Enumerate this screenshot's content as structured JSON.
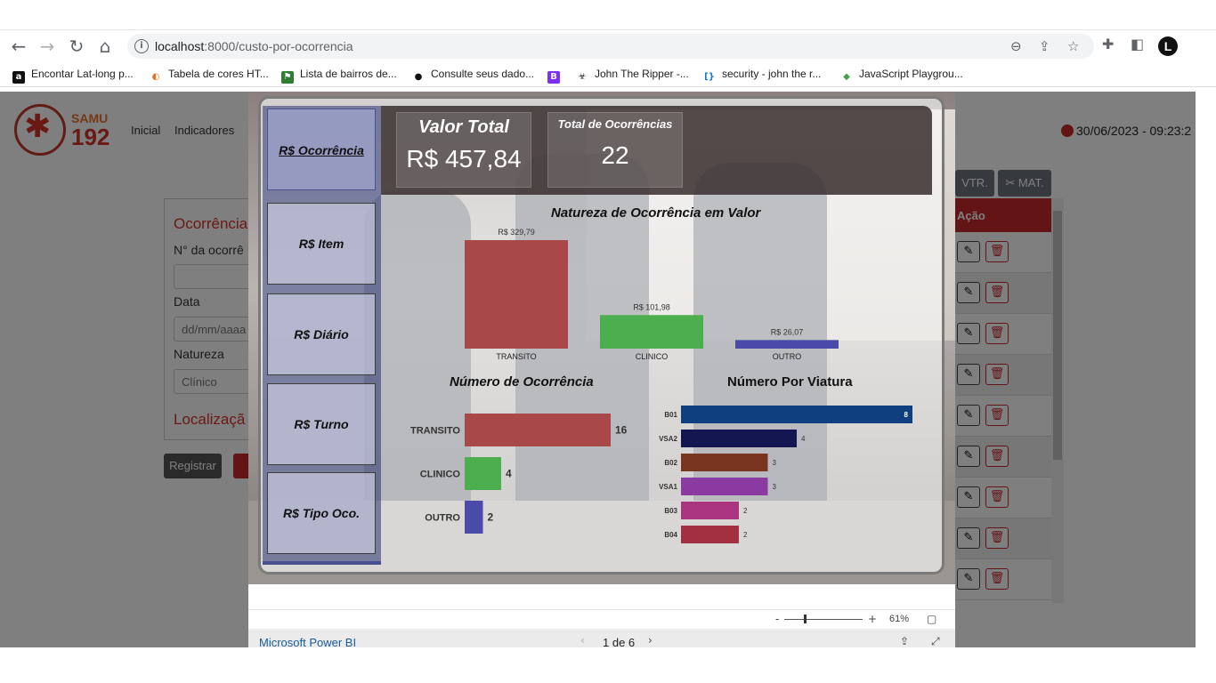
{
  "browser": {
    "url_host": "localhost",
    "url_path": ":8000/custo-por-ocorrencia",
    "bookmarks": [
      {
        "label": "Encontar Lat-long p...",
        "icon": "a",
        "color": "#111"
      },
      {
        "label": "Tabela de cores HT...",
        "icon": "◐",
        "color": "#e8731a"
      },
      {
        "label": "Lista de bairros de...",
        "icon": "⚑",
        "color": "#2e7d32"
      },
      {
        "label": "Consulte seus dado...",
        "icon": "●",
        "color": "#111"
      },
      {
        "label": "",
        "icon": "B",
        "color": "#7b2ff7"
      },
      {
        "label": "John The Ripper -...",
        "icon": "☣",
        "color": "#222"
      },
      {
        "label": "security - john the r...",
        "icon": "[}",
        "color": "#1976d2"
      },
      {
        "label": "JavaScript Playgrou...",
        "icon": "◆",
        "color": "#43a047"
      }
    ],
    "avatar": "L"
  },
  "app": {
    "brand_top": "SAMU",
    "brand_num": "192",
    "nav": [
      "Inicial",
      "Indicadores"
    ],
    "datetime": "30/06/2023 - 09:23:2",
    "form": {
      "title": "Ocorrência",
      "title2": "Localizaçã",
      "label_numero": "N° da ocorrê",
      "label_data": "Data",
      "date_placeholder": "dd/mm/aaaa",
      "label_natureza": "Natureza",
      "natureza_value": "Clínico",
      "register_button": "Registrar"
    },
    "top_buttons": [
      "VTR.",
      "MAT."
    ],
    "table_header": "Ação",
    "row_count": 9
  },
  "report": {
    "nav_buttons": [
      "R$ Ocorrência",
      "R$ Item",
      "R$ Diário",
      "R$ Turno",
      "R$ Tipo Oco."
    ],
    "kpi_total_label": "Valor Total",
    "kpi_total_value": "R$ 457,84",
    "kpi_count_label": "Total de Ocorrências",
    "kpi_count_value": "22",
    "chart1_title": "Natureza de Ocorrência em Valor",
    "chart2_title": "Número de Ocorrência",
    "chart3_title": "Número Por Viatura"
  },
  "chart_data": [
    {
      "type": "bar",
      "title": "Natureza de Ocorrência em Valor",
      "categories": [
        "TRANSITO",
        "CLINICO",
        "OUTRO"
      ],
      "values": [
        329.79,
        101.98,
        26.07
      ],
      "labels": [
        "R$ 329,79",
        "R$ 101,98",
        "R$ 26,07"
      ],
      "colors": [
        "#a84848",
        "#4cae4f",
        "#4a4aa8"
      ]
    },
    {
      "type": "bar",
      "orientation": "horizontal",
      "title": "Número de Ocorrência",
      "categories": [
        "TRANSITO",
        "CLINICO",
        "OUTRO"
      ],
      "values": [
        16,
        4,
        2
      ],
      "colors": [
        "#a84848",
        "#4cae4f",
        "#4a4aa8"
      ]
    },
    {
      "type": "bar",
      "orientation": "horizontal",
      "title": "Número Por Viatura",
      "categories": [
        "B01",
        "VSA2",
        "B02",
        "VSA1",
        "B03",
        "B04"
      ],
      "values": [
        8,
        4,
        3,
        3,
        2,
        2
      ],
      "colors": [
        "#0f3f7e",
        "#141652",
        "#7a3520",
        "#8a3aa0",
        "#a8357e",
        "#a33040"
      ]
    }
  ],
  "pbi": {
    "zoom": "61%",
    "brand": "Microsoft Power BI",
    "page": "1 de 6"
  }
}
